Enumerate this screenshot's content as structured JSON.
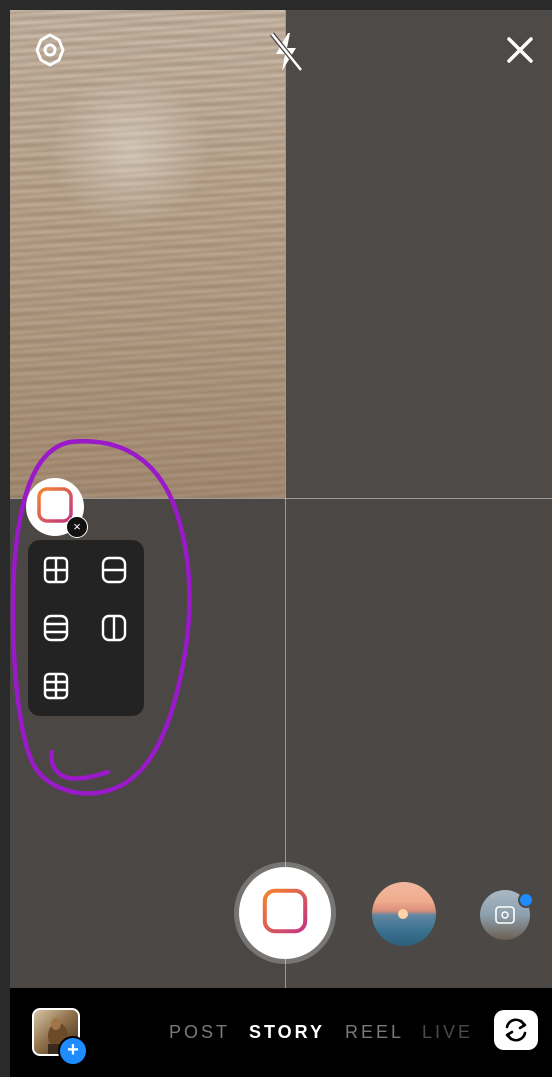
{
  "top_bar": {
    "settings_icon": "settings-gear-icon",
    "flash_icon": "flash-off-icon",
    "close_icon": "close-icon"
  },
  "layout_tool": {
    "toggle_icon": "layout-icon",
    "close_glyph": "×",
    "options": [
      "grid-4-icon",
      "split-horizontal-icon",
      "split-3-horizontal-icon",
      "split-vertical-icon",
      "grid-6-icon"
    ]
  },
  "capture": {
    "icon": "layout-icon"
  },
  "effects": {
    "thumbnails": [
      "sunset-effect",
      "camera-effect"
    ]
  },
  "bottom_bar": {
    "modes": [
      "POST",
      "STORY",
      "REEL",
      "LIVE"
    ],
    "active_mode": "STORY",
    "gallery_plus": "+",
    "flip_camera_icon": "flip-camera-icon"
  },
  "colors": {
    "annotation": "#9a19c9",
    "accent_blue": "#1e8cff",
    "layout_gradient_start": "#f58529",
    "layout_gradient_end": "#c13584"
  }
}
